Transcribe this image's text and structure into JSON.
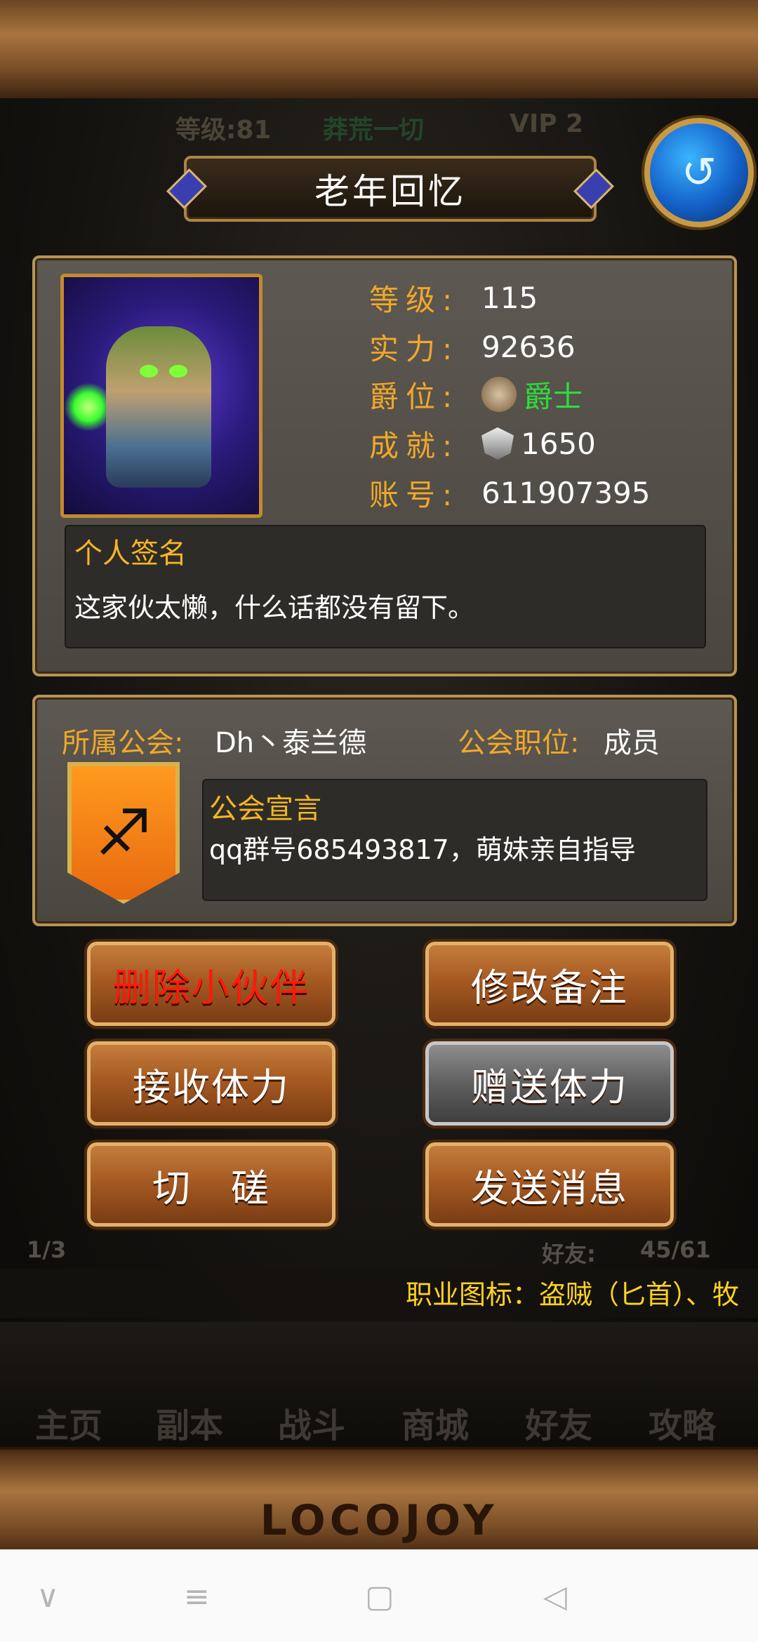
{
  "header": {
    "title": "老年回忆",
    "back_icon": "swirl-back-icon",
    "bg_level": "等级:81",
    "bg_slogan": "莽荒一切",
    "bg_vip": "VIP 2"
  },
  "profile": {
    "stats": [
      {
        "label": "等级:",
        "value": "115"
      },
      {
        "label": "实力:",
        "value": "92636"
      },
      {
        "label": "爵位:",
        "value": "爵士"
      },
      {
        "label": "成就:",
        "value": "1650"
      },
      {
        "label": "账号:",
        "value": "611907395"
      }
    ],
    "signature_title": "个人签名",
    "signature_text": "这家伙太懒，什么话都没有留下。"
  },
  "guild": {
    "guild_label": "所属公会:",
    "guild_name": "Dh丶泰兰德",
    "position_label": "公会职位:",
    "position_value": "成员",
    "declaration_title": "公会宣言",
    "declaration_text": "qq群号685493817，萌妹亲自指导"
  },
  "actions": {
    "delete_friend": "删除小伙伴",
    "edit_note": "修改备注",
    "receive_stamina": "接收体力",
    "send_stamina": "赠送体力",
    "duel": "切　磋",
    "send_message": "发送消息"
  },
  "list_footer": {
    "page": "1/3",
    "friends_label": "好友:",
    "friends_count": "45/61"
  },
  "ticker": "职业图标：盗贼（匕首）、牧",
  "bottom_nav": [
    "主页",
    "副本",
    "战斗",
    "商城",
    "好友",
    "攻略"
  ],
  "logo": "LOCOJOY",
  "colors": {
    "label_gold": "#f0a82a",
    "rank_green": "#2fdc3a",
    "delete_red": "#ff1a0a",
    "ticker_yellow": "#ffd21f"
  }
}
